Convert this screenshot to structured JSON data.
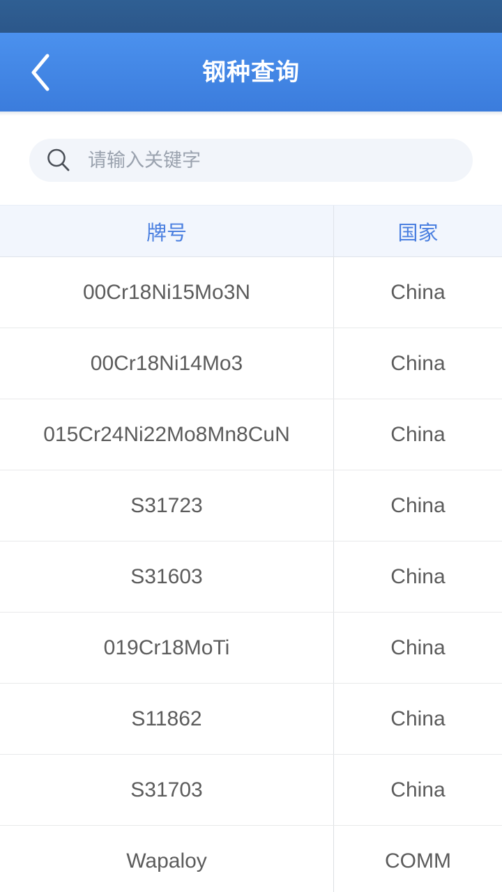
{
  "status_bar": {
    "background_color": "#2d5b8e"
  },
  "header": {
    "title": "钢种查询",
    "back_icon": "chevron-left-icon",
    "background_color": "#4285e8",
    "title_color": "#ffffff"
  },
  "search": {
    "placeholder": "请输入关键字",
    "value": "",
    "icon": "search-icon",
    "background_color": "#f2f5fa"
  },
  "table": {
    "header_color": "#4a7fe0",
    "header_background": "#f2f6fd",
    "columns": [
      {
        "key": "grade",
        "label": "牌号"
      },
      {
        "key": "country",
        "label": "国家"
      }
    ],
    "rows": [
      {
        "grade": "00Cr18Ni15Mo3N",
        "country": "China"
      },
      {
        "grade": "00Cr18Ni14Mo3",
        "country": "China"
      },
      {
        "grade": "015Cr24Ni22Mo8Mn8CuN",
        "country": "China"
      },
      {
        "grade": "S31723",
        "country": "China"
      },
      {
        "grade": "S31603",
        "country": "China"
      },
      {
        "grade": "019Cr18MoTi",
        "country": "China"
      },
      {
        "grade": "S11862",
        "country": "China"
      },
      {
        "grade": "S31703",
        "country": "China"
      },
      {
        "grade": "Wapaloy",
        "country": "COMM"
      }
    ]
  }
}
